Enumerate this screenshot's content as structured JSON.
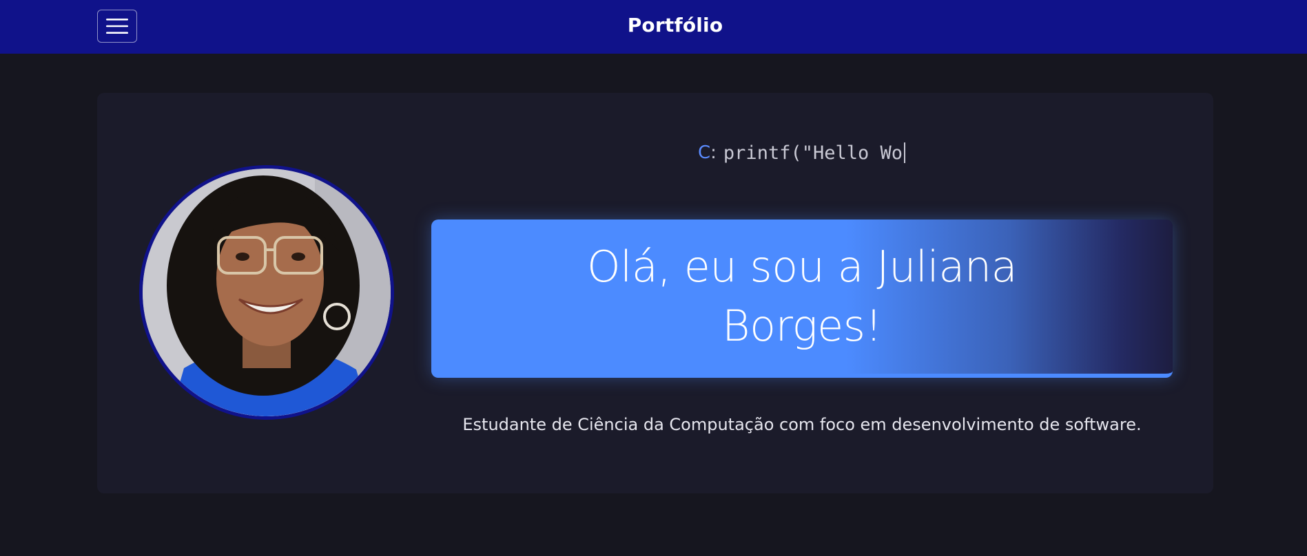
{
  "header": {
    "menu_icon": "hamburger-menu-icon",
    "brand": "Portfólio"
  },
  "hero": {
    "avatar_alt": "profile-photo",
    "typing": {
      "language": "C",
      "separator": ":",
      "code": "printf(\"Hello Wo"
    },
    "title": "Olá, eu sou a Juliana Borges!",
    "subtitle": "Estudante de Ciência da Computação com foco em desenvolvimento de software."
  },
  "colors": {
    "navbar": "#10128a",
    "background": "#16161f",
    "card": "#1b1b2a",
    "accent": "#4c8bff"
  }
}
